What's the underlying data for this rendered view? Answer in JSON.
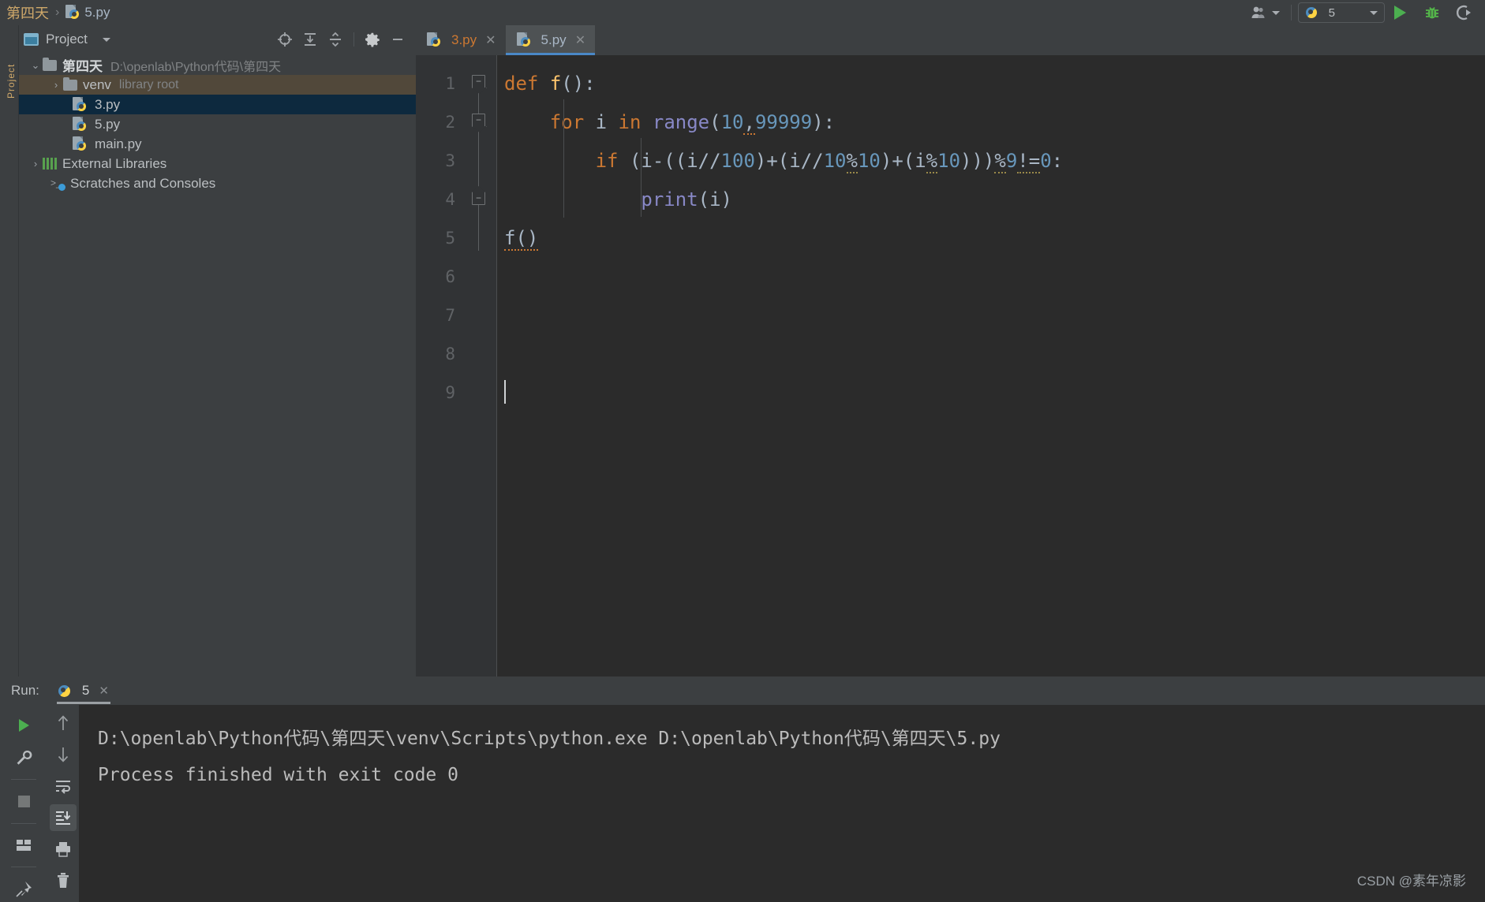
{
  "breadcrumb": {
    "project": "第四天",
    "separator": "›",
    "file": "5.py",
    "file_icon": "python-file-icon"
  },
  "toolbar": {
    "user_icon": "user-silhouette-icon",
    "run_config_name": "5",
    "run_config_icon": "python-icon",
    "dropdown_icon": "chevron-down-icon",
    "run_icon": "run-play-icon",
    "debug_icon": "debug-bug-icon",
    "coverage_icon": "coverage-icon"
  },
  "project_panel": {
    "title": "Project",
    "dropdown_icon": "chevron-down-icon",
    "window_icon": "project-window-icon",
    "tools": [
      {
        "name": "locate-target-icon",
        "glyph": "⊕"
      },
      {
        "name": "expand-all-icon",
        "glyph": "↧"
      },
      {
        "name": "collapse-all-icon",
        "glyph": "↥"
      },
      {
        "name": "settings-gear-icon",
        "glyph": "⚙"
      },
      {
        "name": "hide-panel-icon",
        "glyph": "—"
      }
    ],
    "tree": [
      {
        "label": "第四天",
        "detail": "D:\\openlab\\Python代码\\第四天",
        "icon": "folder-icon",
        "arrow": "⌄",
        "indent": 0,
        "state": "normal",
        "bold": true
      },
      {
        "label": "venv",
        "detail": "library root",
        "icon": "folder-icon",
        "arrow": "›",
        "indent": 1,
        "state": "hovered",
        "bold": false
      },
      {
        "label": "3.py",
        "detail": "",
        "icon": "python-file-icon",
        "arrow": "",
        "indent": 2,
        "state": "selected",
        "bold": false
      },
      {
        "label": "5.py",
        "detail": "",
        "icon": "python-file-icon",
        "arrow": "",
        "indent": 2,
        "state": "normal",
        "bold": false
      },
      {
        "label": "main.py",
        "detail": "",
        "icon": "python-file-icon",
        "arrow": "",
        "indent": 2,
        "state": "normal",
        "bold": false
      },
      {
        "label": "External Libraries",
        "detail": "",
        "icon": "external-libraries-icon",
        "arrow": "›",
        "indent": 0,
        "state": "normal",
        "bold": false
      },
      {
        "label": "Scratches and Consoles",
        "detail": "",
        "icon": "scratches-icon",
        "arrow": "",
        "indent": 1,
        "state": "normal",
        "bold": false
      }
    ]
  },
  "editor": {
    "tabs": [
      {
        "label": "3.py",
        "icon": "python-file-icon",
        "close_icon": "close-icon",
        "active": false,
        "modified": true
      },
      {
        "label": "5.py",
        "icon": "python-file-icon",
        "close_icon": "close-icon",
        "active": true,
        "modified": false
      }
    ],
    "line_numbers": [
      "1",
      "2",
      "3",
      "4",
      "5",
      "6",
      "7",
      "8",
      "9"
    ],
    "code_lines": [
      {
        "n": 1,
        "text": "def f():"
      },
      {
        "n": 2,
        "text": "    for i in range(10,99999):"
      },
      {
        "n": 3,
        "text": "        if (i-((i//100)+(i//10%10)+(i%10)))%9!=0:"
      },
      {
        "n": 4,
        "text": "            print(i)"
      },
      {
        "n": 5,
        "text": "f()"
      },
      {
        "n": 6,
        "text": ""
      },
      {
        "n": 7,
        "text": ""
      },
      {
        "n": 8,
        "text": ""
      },
      {
        "n": 9,
        "text": ""
      }
    ]
  },
  "run_panel": {
    "label": "Run:",
    "tab_label": "5",
    "tab_icon": "python-icon",
    "tab_close_icon": "close-icon",
    "left_tools": [
      {
        "name": "rerun-play-icon",
        "glyph": "▶",
        "color": "#4caf50"
      },
      {
        "name": "edit-configurations-wrench-icon",
        "glyph": "ὒ7"
      },
      {
        "name": "stop-icon",
        "glyph": "■"
      },
      {
        "name": "layout-icon",
        "glyph": "▣"
      },
      {
        "name": "pin-tab-icon",
        "glyph": "ὌC"
      }
    ],
    "right_tools": [
      {
        "name": "scroll-up-icon",
        "glyph": "↑"
      },
      {
        "name": "scroll-down-icon",
        "glyph": "↓"
      },
      {
        "name": "soft-wrap-icon",
        "glyph": "↵"
      },
      {
        "name": "scroll-to-end-icon",
        "glyph": "⤓"
      },
      {
        "name": "print-icon",
        "glyph": "⎙"
      },
      {
        "name": "clear-all-trash-icon",
        "glyph": "Ὕ1"
      }
    ],
    "console_lines": [
      "D:\\openlab\\Python代码\\第四天\\venv\\Scripts\\python.exe D:\\openlab\\Python代码\\第四天\\5.py",
      "",
      "Process finished with exit code 0"
    ]
  },
  "watermark": "CSDN @素年凉影",
  "colors": {
    "background": "#3c3f41",
    "editor_background": "#2b2b2b",
    "accent_blue": "#4a88c7",
    "selection": "#0d293e",
    "hover": "#51483a",
    "keyword_orange": "#cc7832",
    "number_blue": "#6897bb",
    "builtin_purple": "#8888c6",
    "function_yellow": "#ffc66d",
    "text": "#a9b7c6",
    "green": "#4caf50"
  }
}
